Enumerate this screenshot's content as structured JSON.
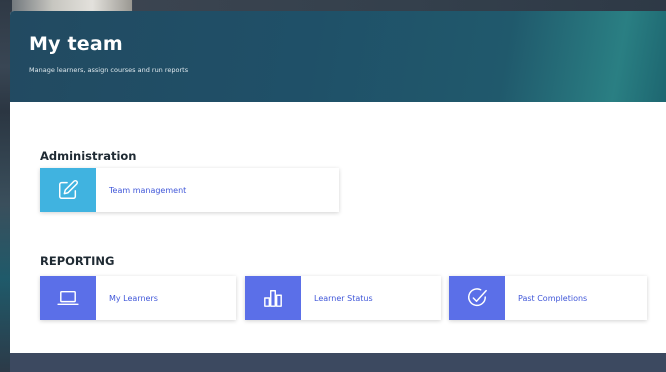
{
  "header": {
    "title": "My team",
    "subtitle": "Manage learners, assign courses and run reports"
  },
  "sections": {
    "administration": {
      "title": "Administration",
      "tiles": [
        {
          "label": "Team management",
          "icon": "edit-icon",
          "color": "#40b3e0"
        }
      ]
    },
    "reporting": {
      "title": "REPORTING",
      "tiles": [
        {
          "label": "My Learners",
          "icon": "laptop-icon",
          "color": "#5b6fe8"
        },
        {
          "label": "Learner Status",
          "icon": "bar-chart-icon",
          "color": "#5b6fe8"
        },
        {
          "label": "Past Completions",
          "icon": "check-circle-icon",
          "color": "#5b6fe8"
        }
      ]
    }
  },
  "colors": {
    "header_gradient_start": "#224a61",
    "header_gradient_end": "#2a7f83",
    "admin_accent": "#40b3e0",
    "reporting_accent": "#5b6fe8",
    "link_text": "#4057d9",
    "footer": "#3c4960"
  }
}
